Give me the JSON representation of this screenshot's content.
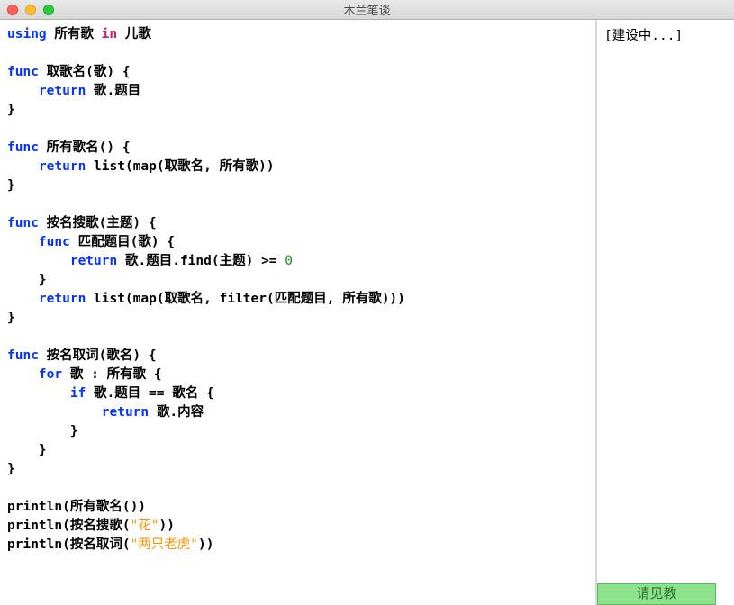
{
  "window": {
    "title": "木兰笔谈"
  },
  "editor": {
    "tokens": [
      [
        [
          "kw",
          "using"
        ],
        [
          "sp",
          " "
        ],
        [
          "id",
          "所有歌"
        ],
        [
          "sp",
          " "
        ],
        [
          "mod",
          "in"
        ],
        [
          "sp",
          " "
        ],
        [
          "id",
          "儿歌"
        ]
      ],
      [],
      [
        [
          "kw",
          "func"
        ],
        [
          "sp",
          " "
        ],
        [
          "fn",
          "取歌名"
        ],
        [
          "punct",
          "("
        ],
        [
          "id",
          "歌"
        ],
        [
          "punct",
          ")"
        ],
        [
          "sp",
          " "
        ],
        [
          "punct",
          "{"
        ]
      ],
      [
        [
          "sp",
          "    "
        ],
        [
          "kw",
          "return"
        ],
        [
          "sp",
          " "
        ],
        [
          "id",
          "歌"
        ],
        [
          "op",
          "."
        ],
        [
          "id",
          "题目"
        ]
      ],
      [
        [
          "punct",
          "}"
        ]
      ],
      [],
      [
        [
          "kw",
          "func"
        ],
        [
          "sp",
          " "
        ],
        [
          "fn",
          "所有歌名"
        ],
        [
          "punct",
          "()"
        ],
        [
          "sp",
          " "
        ],
        [
          "punct",
          "{"
        ]
      ],
      [
        [
          "sp",
          "    "
        ],
        [
          "kw",
          "return"
        ],
        [
          "sp",
          " "
        ],
        [
          "fn",
          "list"
        ],
        [
          "punct",
          "("
        ],
        [
          "fn",
          "map"
        ],
        [
          "punct",
          "("
        ],
        [
          "id",
          "取歌名"
        ],
        [
          "op",
          ","
        ],
        [
          "sp",
          " "
        ],
        [
          "id",
          "所有歌"
        ],
        [
          "punct",
          "))"
        ]
      ],
      [
        [
          "punct",
          "}"
        ]
      ],
      [],
      [
        [
          "kw",
          "func"
        ],
        [
          "sp",
          " "
        ],
        [
          "fn",
          "按名搜歌"
        ],
        [
          "punct",
          "("
        ],
        [
          "id",
          "主题"
        ],
        [
          "punct",
          ")"
        ],
        [
          "sp",
          " "
        ],
        [
          "punct",
          "{"
        ]
      ],
      [
        [
          "sp",
          "    "
        ],
        [
          "kw",
          "func"
        ],
        [
          "sp",
          " "
        ],
        [
          "fn",
          "匹配题目"
        ],
        [
          "punct",
          "("
        ],
        [
          "id",
          "歌"
        ],
        [
          "punct",
          ")"
        ],
        [
          "sp",
          " "
        ],
        [
          "punct",
          "{"
        ]
      ],
      [
        [
          "sp",
          "        "
        ],
        [
          "kw",
          "return"
        ],
        [
          "sp",
          " "
        ],
        [
          "id",
          "歌"
        ],
        [
          "op",
          "."
        ],
        [
          "id",
          "题目"
        ],
        [
          "op",
          "."
        ],
        [
          "fn",
          "find"
        ],
        [
          "punct",
          "("
        ],
        [
          "id",
          "主题"
        ],
        [
          "punct",
          ")"
        ],
        [
          "sp",
          " "
        ],
        [
          "op",
          ">="
        ],
        [
          "sp",
          " "
        ],
        [
          "num",
          "0"
        ]
      ],
      [
        [
          "sp",
          "    "
        ],
        [
          "punct",
          "}"
        ]
      ],
      [
        [
          "sp",
          "    "
        ],
        [
          "kw",
          "return"
        ],
        [
          "sp",
          " "
        ],
        [
          "fn",
          "list"
        ],
        [
          "punct",
          "("
        ],
        [
          "fn",
          "map"
        ],
        [
          "punct",
          "("
        ],
        [
          "id",
          "取歌名"
        ],
        [
          "op",
          ","
        ],
        [
          "sp",
          " "
        ],
        [
          "fn",
          "filter"
        ],
        [
          "punct",
          "("
        ],
        [
          "id",
          "匹配题目"
        ],
        [
          "op",
          ","
        ],
        [
          "sp",
          " "
        ],
        [
          "id",
          "所有歌"
        ],
        [
          "punct",
          ")))"
        ]
      ],
      [
        [
          "punct",
          "}"
        ]
      ],
      [],
      [
        [
          "kw",
          "func"
        ],
        [
          "sp",
          " "
        ],
        [
          "fn",
          "按名取词"
        ],
        [
          "punct",
          "("
        ],
        [
          "id",
          "歌名"
        ],
        [
          "punct",
          ")"
        ],
        [
          "sp",
          " "
        ],
        [
          "punct",
          "{"
        ]
      ],
      [
        [
          "sp",
          "    "
        ],
        [
          "kw",
          "for"
        ],
        [
          "sp",
          " "
        ],
        [
          "id",
          "歌"
        ],
        [
          "sp",
          " "
        ],
        [
          "op",
          ":"
        ],
        [
          "sp",
          " "
        ],
        [
          "id",
          "所有歌"
        ],
        [
          "sp",
          " "
        ],
        [
          "punct",
          "{"
        ]
      ],
      [
        [
          "sp",
          "        "
        ],
        [
          "kw",
          "if"
        ],
        [
          "sp",
          " "
        ],
        [
          "id",
          "歌"
        ],
        [
          "op",
          "."
        ],
        [
          "id",
          "题目"
        ],
        [
          "sp",
          " "
        ],
        [
          "op",
          "=="
        ],
        [
          "sp",
          " "
        ],
        [
          "id",
          "歌名"
        ],
        [
          "sp",
          " "
        ],
        [
          "punct",
          "{"
        ]
      ],
      [
        [
          "sp",
          "            "
        ],
        [
          "kw",
          "return"
        ],
        [
          "sp",
          " "
        ],
        [
          "id",
          "歌"
        ],
        [
          "op",
          "."
        ],
        [
          "id",
          "内容"
        ]
      ],
      [
        [
          "sp",
          "        "
        ],
        [
          "punct",
          "}"
        ]
      ],
      [
        [
          "sp",
          "    "
        ],
        [
          "punct",
          "}"
        ]
      ],
      [
        [
          "punct",
          "}"
        ]
      ],
      [],
      [
        [
          "fn",
          "println"
        ],
        [
          "punct",
          "("
        ],
        [
          "id",
          "所有歌名"
        ],
        [
          "punct",
          "())"
        ]
      ],
      [
        [
          "fn",
          "println"
        ],
        [
          "punct",
          "("
        ],
        [
          "id",
          "按名搜歌"
        ],
        [
          "punct",
          "("
        ],
        [
          "str",
          "\"花\""
        ],
        [
          "punct",
          "))"
        ]
      ],
      [
        [
          "fn",
          "println"
        ],
        [
          "punct",
          "("
        ],
        [
          "id",
          "按名取词"
        ],
        [
          "punct",
          "("
        ],
        [
          "str",
          "\"两只老虎\""
        ],
        [
          "punct",
          "))"
        ]
      ]
    ]
  },
  "sidebar": {
    "content": "[建设中...]",
    "button_label": "请见教"
  }
}
